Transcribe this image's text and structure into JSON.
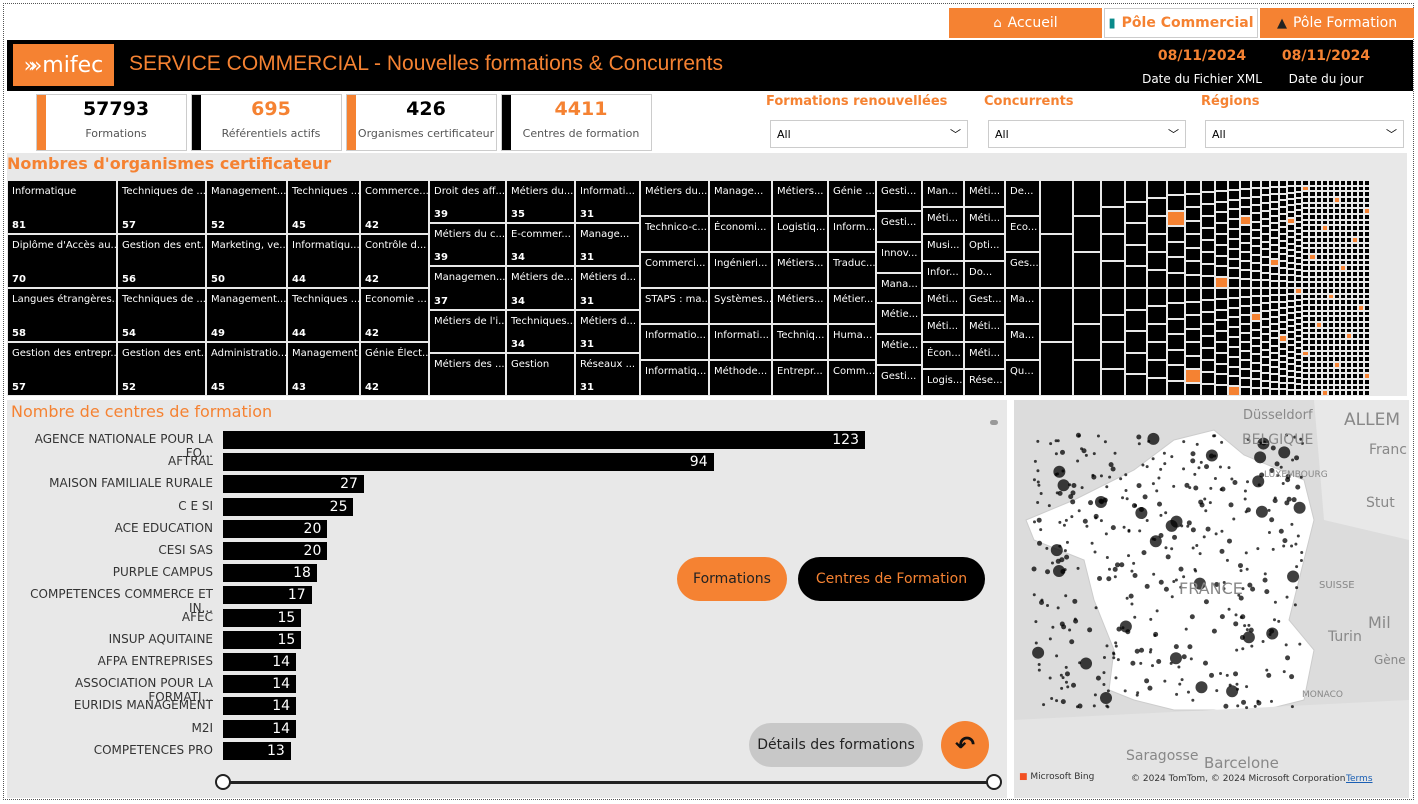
{
  "nav": {
    "tabs": [
      {
        "label": "Accueil",
        "icon": "home-icon"
      },
      {
        "label": "Pôle Commercial",
        "icon": "book-icon"
      },
      {
        "label": "Pôle Formation",
        "icon": "graduation-cap-icon"
      }
    ]
  },
  "header": {
    "logo_text": "mifec",
    "title": "SERVICE COMMERCIAL - Nouvelles formations & Concurrents",
    "date_xml": {
      "value": "08/11/2024",
      "label": "Date du Fichier XML"
    },
    "date_today": {
      "value": "08/11/2024",
      "label": "Date du jour"
    }
  },
  "kpis": [
    {
      "value": "57793",
      "label": "Formations",
      "value_color": "#000",
      "bar_color": "#f58232"
    },
    {
      "value": "695",
      "label": "Référentiels actifs",
      "value_color": "#f58232",
      "bar_color": "#000"
    },
    {
      "value": "426",
      "label": "Organismes certificateur",
      "value_color": "#000",
      "bar_color": "#f58232"
    },
    {
      "value": "4411",
      "label": "Centres de formation",
      "value_color": "#f58232",
      "bar_color": "#000"
    }
  ],
  "slicers": [
    {
      "title": "Formations renouvellées",
      "value": "All"
    },
    {
      "title": "Concurrents",
      "value": "All"
    },
    {
      "title": "Régions",
      "value": "All"
    }
  ],
  "treemap": {
    "title": "Nombres d'organismes certificateur",
    "columns": [
      [
        {
          "n": "Informatique",
          "c": "81"
        },
        {
          "n": "Diplôme d'Accès au...",
          "c": "70"
        },
        {
          "n": "Langues étrangères...",
          "c": "58"
        },
        {
          "n": "Gestion des entrepr...",
          "c": "57"
        }
      ],
      [
        {
          "n": "Techniques de ...",
          "c": "57"
        },
        {
          "n": "Gestion des ent...",
          "c": "56"
        },
        {
          "n": "Techniques de ...",
          "c": "54"
        },
        {
          "n": "Gestion des ent...",
          "c": "52"
        }
      ],
      [
        {
          "n": "Management...",
          "c": "52"
        },
        {
          "n": "Marketing, ve...",
          "c": "50"
        },
        {
          "n": "Management...",
          "c": "49"
        },
        {
          "n": "Administratio...",
          "c": "45"
        }
      ],
      [
        {
          "n": "Techniques ...",
          "c": "45"
        },
        {
          "n": "Informatiqu...",
          "c": "44"
        },
        {
          "n": "Techniques ...",
          "c": "44"
        },
        {
          "n": "Management",
          "c": "43"
        }
      ],
      [
        {
          "n": "Commerce...",
          "c": "42"
        },
        {
          "n": "Contrôle d...",
          "c": "42"
        },
        {
          "n": "Economie ...",
          "c": "42"
        },
        {
          "n": "Génie Élect...",
          "c": "42"
        }
      ],
      [
        {
          "n": "Droit des aff...",
          "c": "39"
        },
        {
          "n": "Métiers du c...",
          "c": "39"
        },
        {
          "n": "Managemen...",
          "c": "37"
        },
        {
          "n": "Métiers de l'i...",
          "c": ""
        },
        {
          "n": "Métiers des ...",
          "c": ""
        }
      ],
      [
        {
          "n": "Métiers du...",
          "c": "35"
        },
        {
          "n": "E-commer...",
          "c": "34"
        },
        {
          "n": "Métiers de...",
          "c": "34"
        },
        {
          "n": "Techniques...",
          "c": "34"
        },
        {
          "n": "Gestion",
          "c": ""
        }
      ],
      [
        {
          "n": "Informati...",
          "c": "31"
        },
        {
          "n": "Manage...",
          "c": "31"
        },
        {
          "n": "Métiers d...",
          "c": "31"
        },
        {
          "n": "Métiers d...",
          "c": "31"
        },
        {
          "n": "Réseaux ...",
          "c": "31"
        }
      ],
      [
        {
          "n": "Métiers du...",
          "c": ""
        },
        {
          "n": "Technico-c...",
          "c": ""
        },
        {
          "n": "Commerci...",
          "c": ""
        },
        {
          "n": "STAPS : ma...",
          "c": ""
        },
        {
          "n": "Informatio...",
          "c": ""
        },
        {
          "n": "Informatiq...",
          "c": ""
        }
      ],
      [
        {
          "n": "Manage...",
          "c": ""
        },
        {
          "n": "Économi...",
          "c": ""
        },
        {
          "n": "Ingénieri...",
          "c": ""
        },
        {
          "n": "Systèmes...",
          "c": ""
        },
        {
          "n": "Informati...",
          "c": ""
        },
        {
          "n": "Méthode...",
          "c": ""
        }
      ],
      [
        {
          "n": "Métiers...",
          "c": ""
        },
        {
          "n": "Logistiq...",
          "c": ""
        },
        {
          "n": "Métiers...",
          "c": ""
        },
        {
          "n": "Métiers...",
          "c": ""
        },
        {
          "n": "Techniq...",
          "c": ""
        },
        {
          "n": "Entrepr...",
          "c": ""
        }
      ],
      [
        {
          "n": "Génie ...",
          "c": ""
        },
        {
          "n": "Inform...",
          "c": ""
        },
        {
          "n": "Traduc...",
          "c": ""
        },
        {
          "n": "Métier...",
          "c": ""
        },
        {
          "n": "Huma...",
          "c": ""
        },
        {
          "n": "Comm...",
          "c": ""
        }
      ],
      [
        {
          "n": "Gesti...",
          "c": ""
        },
        {
          "n": "Gesti...",
          "c": ""
        },
        {
          "n": "Innov...",
          "c": ""
        },
        {
          "n": "Mana...",
          "c": ""
        },
        {
          "n": "Métie...",
          "c": ""
        },
        {
          "n": "Métie...",
          "c": ""
        },
        {
          "n": "Gesti...",
          "c": ""
        }
      ],
      [
        {
          "n": "Man...",
          "c": ""
        },
        {
          "n": "Méti...",
          "c": ""
        },
        {
          "n": "Musi...",
          "c": ""
        },
        {
          "n": "Infor...",
          "c": ""
        },
        {
          "n": "Méti...",
          "c": ""
        },
        {
          "n": "Méti...",
          "c": ""
        },
        {
          "n": "Écon...",
          "c": ""
        },
        {
          "n": "Logis...",
          "c": ""
        }
      ],
      [
        {
          "n": "Méti...",
          "c": ""
        },
        {
          "n": "Méti...",
          "c": ""
        },
        {
          "n": "Opti...",
          "c": ""
        },
        {
          "n": "Do...",
          "c": ""
        },
        {
          "n": "Gest...",
          "c": ""
        },
        {
          "n": "Méti...",
          "c": ""
        },
        {
          "n": "Méti...",
          "c": ""
        },
        {
          "n": "Rése...",
          "c": ""
        }
      ],
      [
        {
          "n": "De...",
          "c": ""
        },
        {
          "n": "Eco...",
          "c": ""
        },
        {
          "n": "Ges...",
          "c": ""
        },
        {
          "n": "Ma...",
          "c": ""
        },
        {
          "n": "Ma...",
          "c": ""
        },
        {
          "n": "Qu...",
          "c": ""
        }
      ]
    ]
  },
  "bar_chart": {
    "title": "Nombre de centres de formation",
    "xlim": [
      0,
      123
    ],
    "categories": [
      "AGENCE NATIONALE POUR LA FO...",
      "AFTRAL",
      "MAISON FAMILIALE RURALE",
      "C E SI",
      "ACE EDUCATION",
      "CESI SAS",
      "PURPLE CAMPUS",
      "COMPETENCES COMMERCE ET IN...",
      "AFEC",
      "INSUP AQUITAINE",
      "AFPA ENTREPRISES",
      "ASSOCIATION POUR LA FORMATI...",
      "EURIDIS MANAGEMENT",
      "M2I",
      "COMPETENCES PRO"
    ],
    "values": [
      123,
      94,
      27,
      25,
      20,
      20,
      18,
      17,
      15,
      15,
      14,
      14,
      14,
      14,
      13
    ]
  },
  "buttons": {
    "formations": "Formations",
    "centres": "Centres de Formation",
    "details": "Détails des formations"
  },
  "map": {
    "labels": {
      "dusseldorf": "Düsseldorf",
      "allem": "ALLEM",
      "belgique": "BELGIQUE",
      "franc": "Franc",
      "luxembourg": "LUXEMBOURG",
      "stut": "Stut",
      "france": "FRANCE",
      "suisse": "SUISSE",
      "mil": "Mil",
      "turin": "Turin",
      "gene": "Gène",
      "monaco": "MONACO",
      "saragosse": "Saragosse",
      "barcelone": "Barcelone"
    },
    "attribution": "© 2024 TomTom, © 2024 Microsoft Corporation",
    "terms": "Terms",
    "bing": "Microsoft Bing"
  },
  "colors": {
    "accent": "#f58232",
    "dark": "#000000",
    "panel": "#e8e8e8"
  }
}
